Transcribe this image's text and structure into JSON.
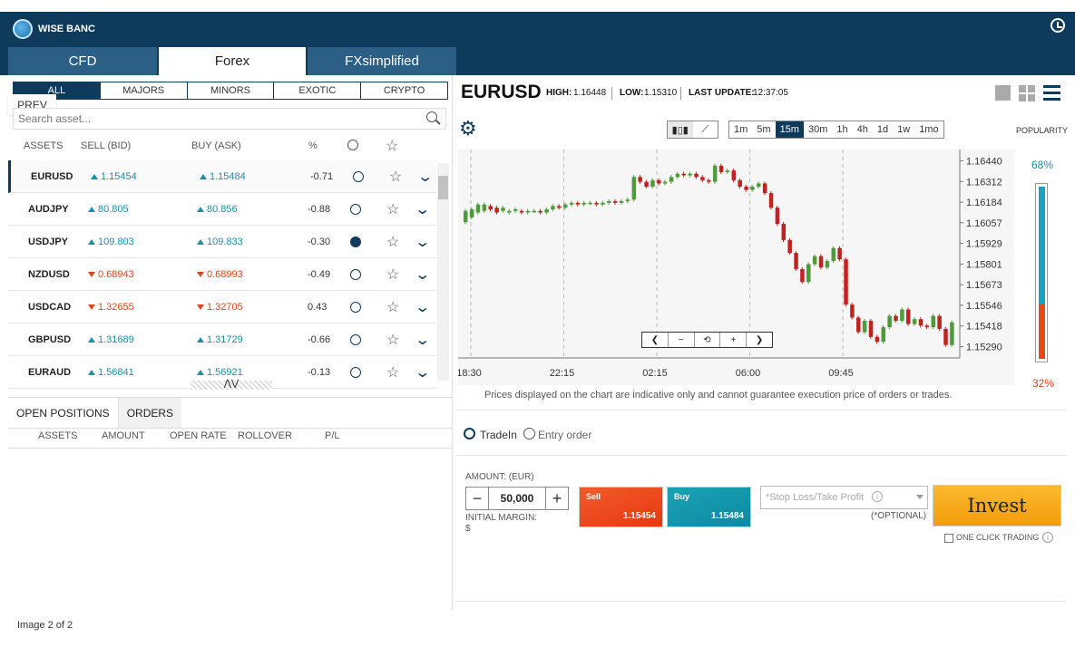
{
  "brand": {
    "name": "WISE BANC"
  },
  "top_tabs": [
    {
      "label": "CFD"
    },
    {
      "label": "Forex"
    },
    {
      "label": "FXsimplified"
    }
  ],
  "categories": [
    "ALL",
    "MAJORS",
    "MINORS",
    "EXOTIC",
    "CRYPTO"
  ],
  "prev_label": "PREV",
  "search": {
    "placeholder": "Search asset..."
  },
  "columns": {
    "assets": "ASSETS",
    "sell": "SELL (BID)",
    "buy": "BUY (ASK)",
    "pct": "%"
  },
  "rows": [
    {
      "symbol": "EURUSD",
      "bid": "1.15454",
      "ask": "1.15484",
      "pct": "-0.71",
      "dir": "up"
    },
    {
      "symbol": "AUDJPY",
      "bid": "80.805",
      "ask": "80.856",
      "pct": "-0.88",
      "dir": "up"
    },
    {
      "symbol": "USDJPY",
      "bid": "109.803",
      "ask": "109.833",
      "pct": "-0.30",
      "dir": "up"
    },
    {
      "symbol": "NZDUSD",
      "bid": "0.68943",
      "ask": "0.68993",
      "pct": "-0.49",
      "dir": "down"
    },
    {
      "symbol": "USDCAD",
      "bid": "1.32655",
      "ask": "1.32705",
      "pct": "0.43",
      "dir": "down"
    },
    {
      "symbol": "GBPUSD",
      "bid": "1.31689",
      "ask": "1.31729",
      "pct": "-0.66",
      "dir": "up"
    },
    {
      "symbol": "EURAUD",
      "bid": "1.56841",
      "ask": "1.56921",
      "pct": "-0.13",
      "dir": "up"
    }
  ],
  "positions": {
    "tabs": [
      "OPEN POSITIONS",
      "ORDERS"
    ],
    "columns": [
      "ASSETS",
      "AMOUNT",
      "OPEN RATE",
      "ROLLOVER",
      "P/L"
    ]
  },
  "image_caption": "Image 2 of 2",
  "instrument": {
    "symbol": "EURUSD",
    "high_label": "HIGH:",
    "high": "1.16448",
    "low_label": "LOW:",
    "low": "1.15310",
    "update_label": "LAST UPDATE:",
    "update": "12:37:05"
  },
  "timeframes": [
    "1m",
    "5m",
    "15m",
    "30m",
    "1h",
    "4h",
    "1d",
    "1w",
    "1mo"
  ],
  "active_timeframe": "15m",
  "popularity": {
    "label": "POPULARITY",
    "buy": "68%",
    "sell": "32%",
    "buy_fraction": 0.68
  },
  "chart_data": {
    "type": "candlestick",
    "y_ticks": [
      "1.16440",
      "1.16312",
      "1.16184",
      "1.16057",
      "1.15929",
      "1.15801",
      "1.15673",
      "1.15546",
      "1.15418",
      "1.15290"
    ],
    "ylim": [
      1.1522,
      1.1651
    ],
    "x_ticks": [
      "18:30",
      "22:15",
      "02:15",
      "06:00",
      "09:45"
    ],
    "candles": [
      [
        1.1606,
        1.1613
      ],
      [
        1.1609,
        1.1614
      ],
      [
        1.1612,
        1.1617
      ],
      [
        1.1613,
        1.1617
      ],
      [
        1.1616,
        1.1614
      ],
      [
        1.1615,
        1.1612
      ],
      [
        1.1613,
        1.1615
      ],
      [
        1.1612,
        1.1613
      ],
      [
        1.1613,
        1.1614
      ],
      [
        1.1613,
        1.1612
      ],
      [
        1.1612,
        1.1613
      ],
      [
        1.1613,
        1.1613
      ],
      [
        1.1613,
        1.1612
      ],
      [
        1.1612,
        1.1614
      ],
      [
        1.1614,
        1.1616
      ],
      [
        1.1616,
        1.1615
      ],
      [
        1.1615,
        1.1617
      ],
      [
        1.1617,
        1.1618
      ],
      [
        1.1618,
        1.1617
      ],
      [
        1.1617,
        1.1618
      ],
      [
        1.1618,
        1.1618
      ],
      [
        1.1618,
        1.1617
      ],
      [
        1.1617,
        1.1618
      ],
      [
        1.1618,
        1.1619
      ],
      [
        1.1619,
        1.1618
      ],
      [
        1.1618,
        1.1619
      ],
      [
        1.1619,
        1.162
      ],
      [
        1.162,
        1.1634
      ],
      [
        1.1634,
        1.1631
      ],
      [
        1.1631,
        1.1628
      ],
      [
        1.1628,
        1.1632
      ],
      [
        1.1632,
        1.163
      ],
      [
        1.163,
        1.1631
      ],
      [
        1.1631,
        1.1634
      ],
      [
        1.1634,
        1.1636
      ],
      [
        1.1636,
        1.1635
      ],
      [
        1.1635,
        1.1636
      ],
      [
        1.1636,
        1.1634
      ],
      [
        1.1634,
        1.1632
      ],
      [
        1.1632,
        1.1631
      ],
      [
        1.1631,
        1.1641
      ],
      [
        1.1641,
        1.1637
      ],
      [
        1.1637,
        1.1638
      ],
      [
        1.1638,
        1.1632
      ],
      [
        1.1632,
        1.1628
      ],
      [
        1.1628,
        1.1626
      ],
      [
        1.1626,
        1.1628
      ],
      [
        1.1628,
        1.163
      ],
      [
        1.163,
        1.1624
      ],
      [
        1.1624,
        1.1615
      ],
      [
        1.1615,
        1.1605
      ],
      [
        1.1605,
        1.1595
      ],
      [
        1.1595,
        1.1587
      ],
      [
        1.1587,
        1.1577
      ],
      [
        1.1577,
        1.1569
      ],
      [
        1.1569,
        1.158
      ],
      [
        1.158,
        1.1585
      ],
      [
        1.1585,
        1.1578
      ],
      [
        1.1578,
        1.1582
      ],
      [
        1.1582,
        1.159
      ],
      [
        1.159,
        1.1583
      ],
      [
        1.1583,
        1.1555
      ],
      [
        1.1555,
        1.1547
      ],
      [
        1.1547,
        1.1538
      ],
      [
        1.1538,
        1.1545
      ],
      [
        1.1545,
        1.1535
      ],
      [
        1.1535,
        1.1532
      ],
      [
        1.1532,
        1.1541
      ],
      [
        1.1541,
        1.1548
      ],
      [
        1.1548,
        1.1545
      ],
      [
        1.1545,
        1.1552
      ],
      [
        1.1552,
        1.1543
      ],
      [
        1.1543,
        1.1546
      ],
      [
        1.1546,
        1.1542
      ],
      [
        1.1542,
        1.1541
      ],
      [
        1.1541,
        1.1548
      ],
      [
        1.1548,
        1.154
      ],
      [
        1.154,
        1.153
      ],
      [
        1.153,
        1.1544
      ]
    ],
    "colors": {
      "up": "#4f9a3a",
      "down": "#c1221f"
    }
  },
  "disclaimer": "Prices displayed on the chart are indicative only and cannot guarantee execution price of orders or trades.",
  "order_types": [
    "TradeIn",
    "Entry order"
  ],
  "trade": {
    "amount_label": "AMOUNT: (EUR)",
    "amount": "50,000",
    "margin_label": "INITIAL MARGIN:",
    "margin_value": "$",
    "sell_label": "Sell",
    "sell_price": "1.15454",
    "buy_label": "Buy",
    "buy_price": "1.15484",
    "sltp_placeholder": "*Stop Loss/Take Profit",
    "optional": "(*OPTIONAL)",
    "invest": "Invest",
    "one_click": "ONE CLICK TRADING"
  },
  "colors": {
    "navy": "#0e3a5c",
    "accent_up": "#1a8fa6",
    "accent_down": "#e0441c",
    "invest": "#f7a81b"
  }
}
